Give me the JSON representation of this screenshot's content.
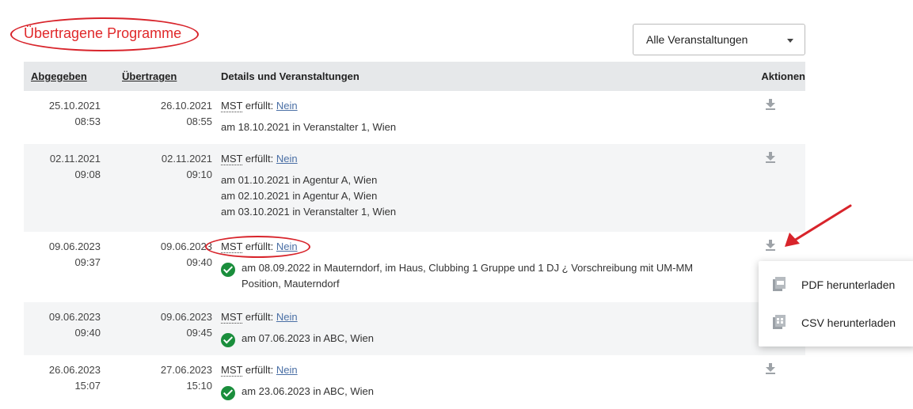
{
  "page_title": "Übertragene Programme",
  "filter": {
    "selected": "Alle Veranstaltungen"
  },
  "columns": {
    "abgegeben": "Abgegeben",
    "uebertragen": "Übertragen",
    "details": "Details und Veranstaltungen",
    "aktionen": "Aktionen"
  },
  "rows": [
    {
      "abg_date": "25.10.2021",
      "abg_time": "08:53",
      "ueb_date": "26.10.2021",
      "ueb_time": "08:55",
      "mst_abbr": "MST",
      "mst_text": "erfüllt:",
      "mst_value": "Nein",
      "events": [
        {
          "text": "am 18.10.2021 in Veranstalter 1, Wien",
          "check": false
        }
      ]
    },
    {
      "abg_date": "02.11.2021",
      "abg_time": "09:08",
      "ueb_date": "02.11.2021",
      "ueb_time": "09:10",
      "mst_abbr": "MST",
      "mst_text": "erfüllt:",
      "mst_value": "Nein",
      "events": [
        {
          "text": "am 01.10.2021 in Agentur A, Wien",
          "check": false
        },
        {
          "text": "am 02.10.2021 in Agentur A, Wien",
          "check": false
        },
        {
          "text": "am 03.10.2021 in Veranstalter 1, Wien",
          "check": false
        }
      ]
    },
    {
      "abg_date": "09.06.2023",
      "abg_time": "09:37",
      "ueb_date": "09.06.2023",
      "ueb_time": "09:40",
      "mst_abbr": "MST",
      "mst_text": "erfüllt:",
      "mst_value": "Nein",
      "events": [
        {
          "text": "am 08.09.2022 in Mauterndorf, im Haus, Clubbing 1 Gruppe und 1 DJ ¿ Vorschreibung mit UM-MM Position, Mauterndorf",
          "check": true
        }
      ]
    },
    {
      "abg_date": "09.06.2023",
      "abg_time": "09:40",
      "ueb_date": "09.06.2023",
      "ueb_time": "09:45",
      "mst_abbr": "MST",
      "mst_text": "erfüllt:",
      "mst_value": "Nein",
      "events": [
        {
          "text": "am 07.06.2023 in ABC, Wien",
          "check": true
        }
      ]
    },
    {
      "abg_date": "26.06.2023",
      "abg_time": "15:07",
      "ueb_date": "27.06.2023",
      "ueb_time": "15:10",
      "mst_abbr": "MST",
      "mst_text": "erfüllt:",
      "mst_value": "Nein",
      "events": [
        {
          "text": "am 23.06.2023 in ABC, Wien",
          "check": true
        }
      ]
    }
  ],
  "download_menu": {
    "pdf_label": "PDF herunterladen",
    "csv_label": "CSV herunterladen"
  },
  "colors": {
    "title_red": "#e0282a",
    "annotation_red": "#d8242b",
    "link_blue": "#4a6fa5",
    "check_green": "#1a8e3c",
    "header_bg": "#e6e8ea",
    "stripe_bg": "#f4f5f6"
  },
  "icons": {
    "download": "download-icon",
    "check": "check-circle-icon",
    "pdf": "pdf-file-icon",
    "csv": "csv-file-icon",
    "dropdown": "chevron-down-icon"
  }
}
